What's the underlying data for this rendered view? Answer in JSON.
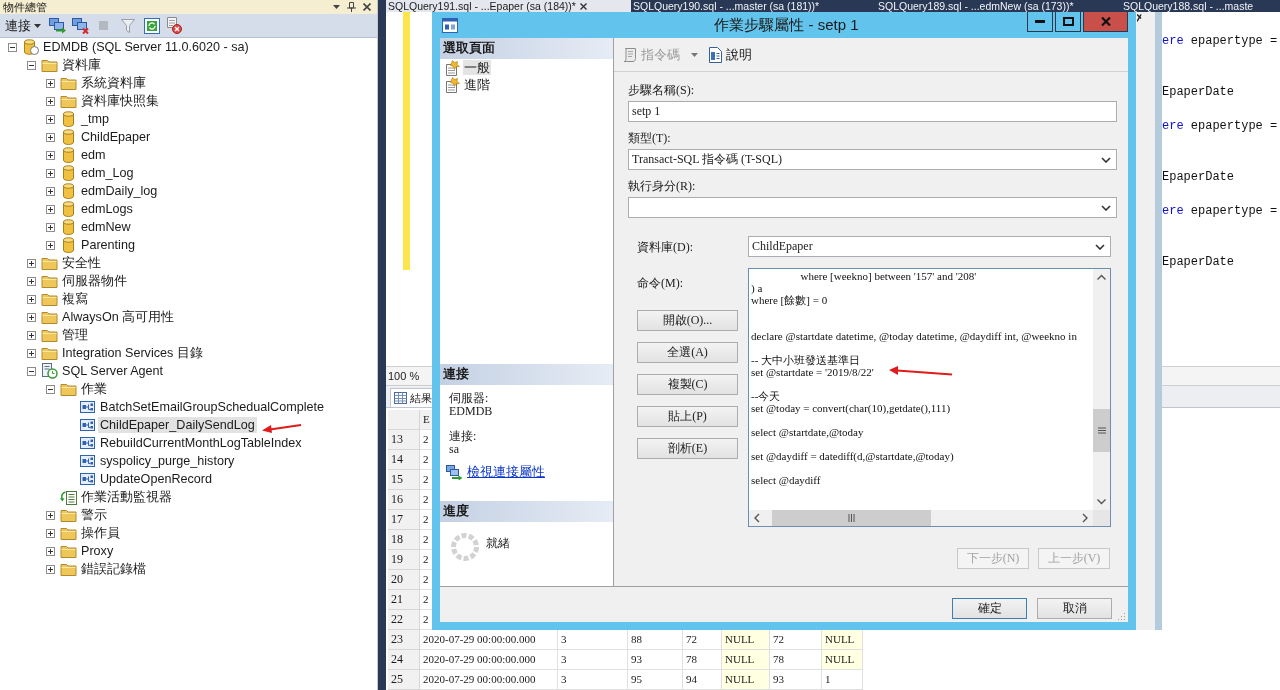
{
  "object_explorer": {
    "title": "物件總管",
    "toolbar": {
      "connect": "連接"
    },
    "tree": [
      {
        "label": "EDMDB (SQL Server 11.0.6020 - sa)",
        "kind": "server",
        "expanded": true,
        "selected": false,
        "children": [
          {
            "label": "資料庫",
            "kind": "folder",
            "expanded": true,
            "selected": false,
            "children": [
              {
                "label": "系統資料庫",
                "kind": "folder",
                "expanded": false,
                "selected": false
              },
              {
                "label": "資料庫快照集",
                "kind": "folder",
                "expanded": false,
                "selected": false
              },
              {
                "label": "_tmp",
                "kind": "database",
                "expanded": false,
                "selected": false
              },
              {
                "label": "ChildEpaper",
                "kind": "database",
                "expanded": false,
                "selected": false
              },
              {
                "label": "edm",
                "kind": "database",
                "expanded": false,
                "selected": false
              },
              {
                "label": "edm_Log",
                "kind": "database",
                "expanded": false,
                "selected": false
              },
              {
                "label": "edmDaily_log",
                "kind": "database",
                "expanded": false,
                "selected": false
              },
              {
                "label": "edmLogs",
                "kind": "database",
                "expanded": false,
                "selected": false
              },
              {
                "label": "edmNew",
                "kind": "database",
                "expanded": false,
                "selected": false
              },
              {
                "label": "Parenting",
                "kind": "database",
                "expanded": false,
                "selected": false
              }
            ]
          },
          {
            "label": "安全性",
            "kind": "folder",
            "expanded": false,
            "selected": false
          },
          {
            "label": "伺服器物件",
            "kind": "folder",
            "expanded": false,
            "selected": false
          },
          {
            "label": "複寫",
            "kind": "folder",
            "expanded": false,
            "selected": false
          },
          {
            "label": "AlwaysOn 高可用性",
            "kind": "folder",
            "expanded": false,
            "selected": false
          },
          {
            "label": "管理",
            "kind": "folder",
            "expanded": false,
            "selected": false
          },
          {
            "label": "Integration Services 目錄",
            "kind": "folder",
            "expanded": false,
            "selected": false
          },
          {
            "label": "SQL Server Agent",
            "kind": "agent",
            "expanded": true,
            "selected": false,
            "children": [
              {
                "label": "作業",
                "kind": "folder",
                "expanded": true,
                "selected": false,
                "children": [
                  {
                    "label": "BatchSetEmailGroupSchedualComplete",
                    "kind": "job",
                    "selected": false
                  },
                  {
                    "label": "ChildEpaper_DailySendLog",
                    "kind": "job",
                    "selected": true
                  },
                  {
                    "label": "RebuildCurrentMonthLogTableIndex",
                    "kind": "job",
                    "selected": false
                  },
                  {
                    "label": "syspolicy_purge_history",
                    "kind": "job",
                    "selected": false
                  },
                  {
                    "label": "UpdateOpenRecord",
                    "kind": "job",
                    "selected": false
                  }
                ]
              },
              {
                "label": "作業活動監視器",
                "kind": "monitor",
                "selected": false
              },
              {
                "label": "警示",
                "kind": "folder",
                "expanded": false,
                "selected": false
              },
              {
                "label": "操作員",
                "kind": "folder",
                "expanded": false,
                "selected": false
              },
              {
                "label": "Proxy",
                "kind": "folder",
                "expanded": false,
                "selected": false
              },
              {
                "label": "錯誤記錄檔",
                "kind": "folder",
                "expanded": false,
                "selected": false
              }
            ]
          }
        ]
      }
    ]
  },
  "document_tabs": [
    {
      "label": "SQLQuery191.sql - ...Epaper (sa (184))*",
      "selected": true
    },
    {
      "label": "SQLQuery190.sql - ...master (sa (181))*",
      "selected": false
    },
    {
      "label": "SQLQuery189.sql - ...edmNew (sa (173))*",
      "selected": false
    },
    {
      "label": "SQLQuery188.sql - ...maste",
      "selected": false
    }
  ],
  "editor": {
    "lines": [
      {
        "tokens": [
          {
            "text": "ere",
            "kind": "keyword"
          },
          {
            "text": " epapertype =",
            "kind": "plain"
          }
        ]
      },
      {
        "tokens": [
          {
            "text": "EpaperDate",
            "kind": "plain"
          }
        ]
      },
      {
        "tokens": [
          {
            "text": "ere",
            "kind": "keyword"
          },
          {
            "text": " epapertype =",
            "kind": "plain"
          }
        ]
      },
      {
        "tokens": [
          {
            "text": "EpaperDate",
            "kind": "plain"
          }
        ]
      },
      {
        "tokens": [
          {
            "text": "ere",
            "kind": "keyword"
          },
          {
            "text": " epapertype =",
            "kind": "plain"
          }
        ]
      },
      {
        "tokens": [
          {
            "text": "EpaperDate",
            "kind": "plain"
          }
        ]
      }
    ]
  },
  "zoom": "100 %",
  "results": {
    "tab": "結果",
    "columns": [
      "E"
    ],
    "rows": [
      {
        "number": "13",
        "cells": [
          {
            "text": "2",
            "null": false
          }
        ]
      },
      {
        "number": "14",
        "cells": [
          {
            "text": "2",
            "null": false
          }
        ]
      },
      {
        "number": "15",
        "cells": [
          {
            "text": "2",
            "null": false
          }
        ]
      },
      {
        "number": "16",
        "cells": [
          {
            "text": "2",
            "null": false
          }
        ]
      },
      {
        "number": "17",
        "cells": [
          {
            "text": "2",
            "null": false
          }
        ]
      },
      {
        "number": "18",
        "cells": [
          {
            "text": "2",
            "null": false
          }
        ]
      },
      {
        "number": "19",
        "cells": [
          {
            "text": "2",
            "null": false
          }
        ]
      },
      {
        "number": "20",
        "cells": [
          {
            "text": "2",
            "null": false
          }
        ]
      },
      {
        "number": "21",
        "cells": [
          {
            "text": "2",
            "null": false
          }
        ]
      },
      {
        "number": "22",
        "cells": [
          {
            "text": "2",
            "null": false
          }
        ]
      },
      {
        "number": "23",
        "cells": [
          {
            "text": "2020-07-29 00:00:00.000",
            "null": false
          },
          {
            "text": "3",
            "null": false
          },
          {
            "text": "88",
            "null": false
          },
          {
            "text": "72",
            "null": false
          },
          {
            "text": "NULL",
            "null": true
          },
          {
            "text": "72",
            "null": false
          },
          {
            "text": "NULL",
            "null": true
          }
        ]
      },
      {
        "number": "24",
        "cells": [
          {
            "text": "2020-07-29 00:00:00.000",
            "null": false
          },
          {
            "text": "3",
            "null": false
          },
          {
            "text": "93",
            "null": false
          },
          {
            "text": "78",
            "null": false
          },
          {
            "text": "NULL",
            "null": true
          },
          {
            "text": "78",
            "null": false
          },
          {
            "text": "NULL",
            "null": true
          }
        ]
      },
      {
        "number": "25",
        "cells": [
          {
            "text": "2020-07-29 00:00:00.000",
            "null": false
          },
          {
            "text": "3",
            "null": false
          },
          {
            "text": "95",
            "null": false
          },
          {
            "text": "94",
            "null": false
          },
          {
            "text": "NULL",
            "null": true
          },
          {
            "text": "93",
            "null": false
          },
          {
            "text": "1",
            "null": false
          }
        ]
      }
    ]
  },
  "dialog": {
    "title": "作業步驟屬性 - setp 1",
    "page_panel": {
      "header": "選取頁面",
      "pages": [
        {
          "label": "一般",
          "selected": true
        },
        {
          "label": "進階",
          "selected": false
        }
      ]
    },
    "connection": {
      "header": "連接",
      "server_label": "伺服器:",
      "server": "EDMDB",
      "login_label": "連接:",
      "login": "sa",
      "link": "檢視連接屬性"
    },
    "progress": {
      "header": "進度",
      "status": "就緒"
    },
    "toolbar": [
      {
        "label": "指令碼",
        "kind": "script",
        "disabled": true
      },
      {
        "label": "說明",
        "kind": "help",
        "disabled": false
      }
    ],
    "fields": [
      {
        "label": "步驟名稱(S):",
        "kind": "text",
        "value": "setp 1"
      },
      {
        "label": "類型(T):",
        "kind": "select",
        "value": "Transact-SQL 指令碼 (T-SQL)"
      },
      {
        "label": "執行身分(R):",
        "kind": "select"
      }
    ],
    "database": {
      "label": "資料庫(D):",
      "value": "ChildEpaper"
    },
    "command": {
      "label": "命令(M):",
      "text": "\t\twhere [weekno] between '157' and '208'\n) a\nwhere [餘數] = 0\n\n\ndeclare @startdate datetime, @today datetime, @daydiff int, @weekno in\n\n-- 大中小班發送基準日\nset @startdate = '2019/8/22'\n\n--今天\nset @today = convert(char(10),getdate(),111)\n\nselect @startdate,@today\n\nset @daydiff = datediff(d,@startdate,@today)\n\nselect @daydiff"
    },
    "command_buttons": [
      "開啟(O)...",
      "全選(A)",
      "複製(C)",
      "貼上(P)",
      "剖析(E)"
    ],
    "step_buttons": [
      {
        "label": "下一步(N)",
        "disabled": true
      },
      {
        "label": "上一步(V)",
        "disabled": true
      }
    ],
    "buttons": [
      {
        "label": "確定",
        "default": true
      },
      {
        "label": "取消",
        "default": false
      }
    ]
  }
}
